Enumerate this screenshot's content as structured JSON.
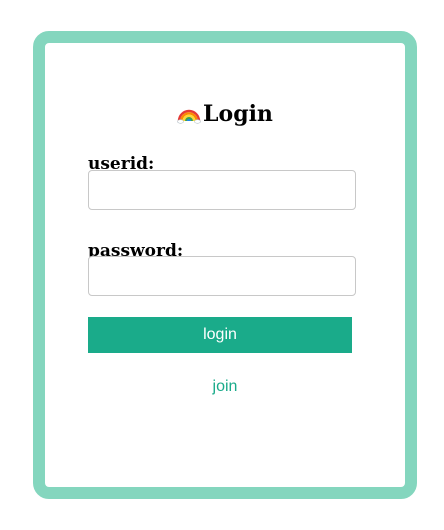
{
  "login_form": {
    "title": "Login",
    "title_icon": "rainbow-icon",
    "userid_label": "userid:",
    "userid_value": "",
    "password_label": "password:",
    "password_value": "",
    "login_button": "login",
    "join_link": "join"
  },
  "colors": {
    "card_border": "#84d6be",
    "accent": "#1aab8a",
    "button_text": "#ffffff",
    "input_border": "#c8c8c8"
  }
}
